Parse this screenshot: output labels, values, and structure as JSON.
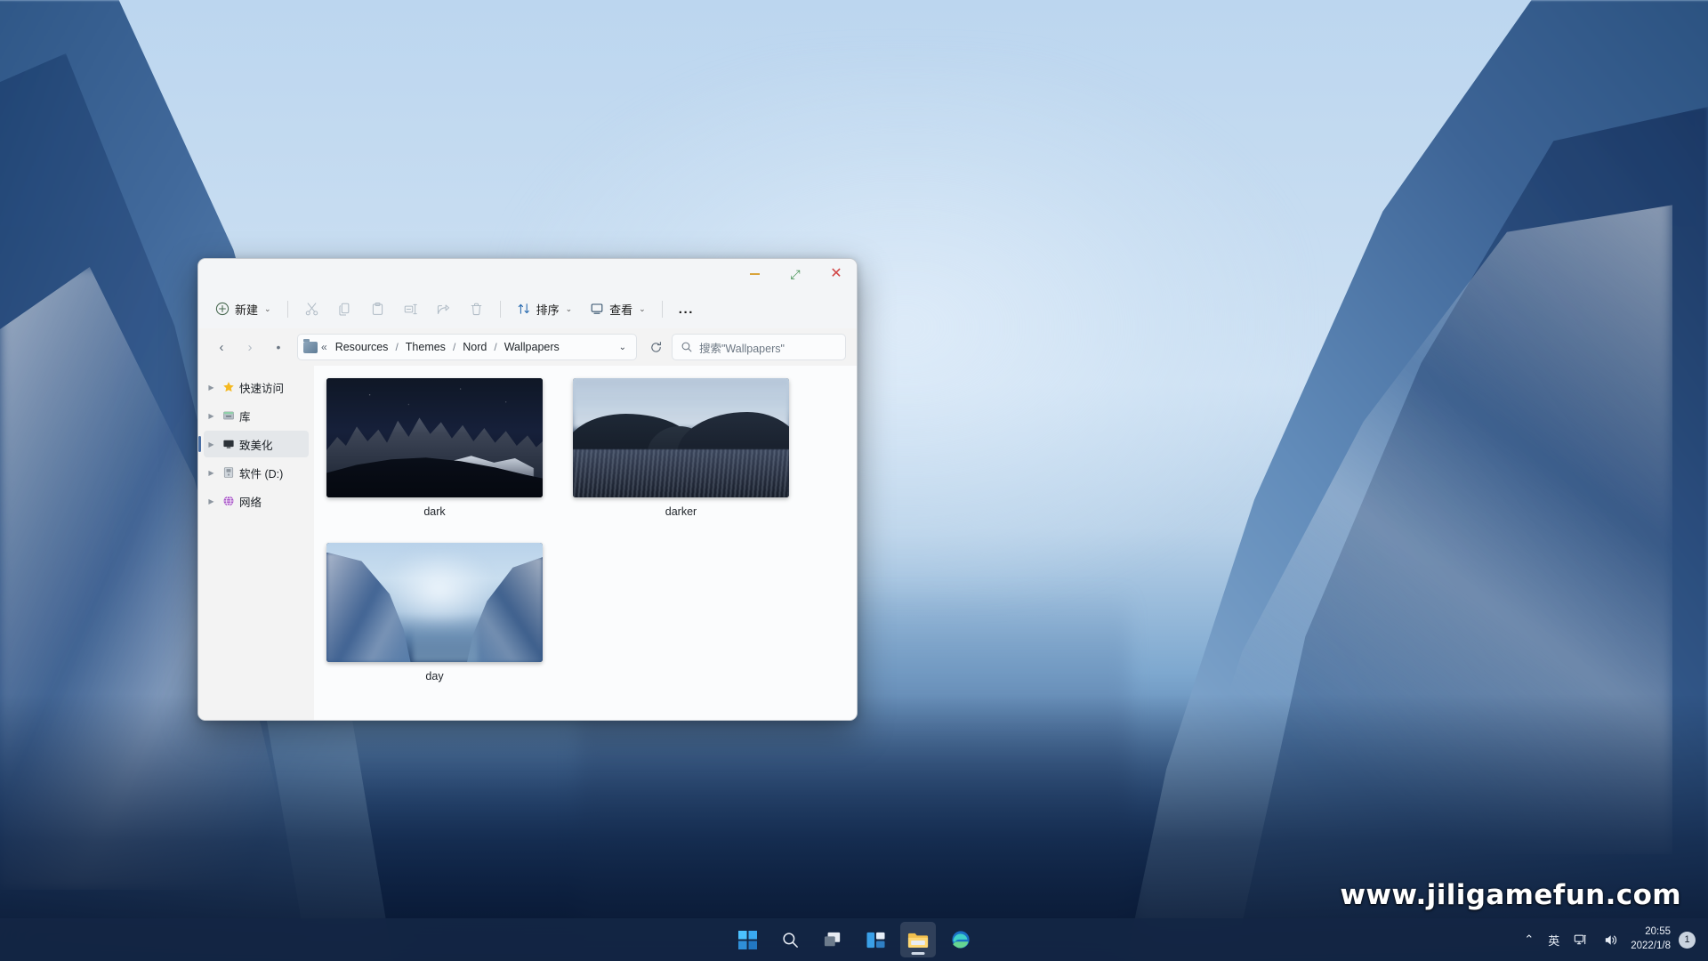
{
  "desktop": {
    "watermark": "www.jiligamefun.com"
  },
  "window": {
    "controls": {
      "minimize": "minimize-button",
      "maximize": "maximize-button",
      "close": "close-button"
    },
    "toolbar": {
      "new_label": "新建",
      "cut_label": "剪切",
      "copy_label": "复制",
      "paste_label": "粘贴",
      "rename_label": "重命名",
      "share_label": "共享",
      "delete_label": "删除",
      "sort_label": "排序",
      "view_label": "查看",
      "more_label": "..."
    },
    "address": {
      "back_label": "←",
      "forward_label": "→",
      "up_label": "↑",
      "overflow_chevron": "«",
      "crumbs": [
        "Resources",
        "Themes",
        "Nord",
        "Wallpapers"
      ],
      "separator": "/",
      "dropdown_label": "⌄",
      "refresh_label": "刷新"
    },
    "search": {
      "placeholder": "搜索\"Wallpapers\"",
      "icon": "search-icon"
    },
    "sidebar": {
      "items": [
        {
          "label": "快速访问",
          "icon": "star-icon",
          "selected": false
        },
        {
          "label": "库",
          "icon": "library-icon",
          "selected": false
        },
        {
          "label": "致美化",
          "icon": "monitor-icon",
          "selected": true
        },
        {
          "label": "软件 (D:)",
          "icon": "drive-icon",
          "selected": false
        },
        {
          "label": "网络",
          "icon": "network-globe-icon",
          "selected": false
        }
      ]
    },
    "files": [
      {
        "name": "dark",
        "art": "dark"
      },
      {
        "name": "darker",
        "art": "darker"
      },
      {
        "name": "day",
        "art": "day"
      }
    ]
  },
  "taskbar": {
    "apps": [
      {
        "name": "start-button",
        "label": "开始"
      },
      {
        "name": "search-button",
        "label": "搜索"
      },
      {
        "name": "task-view-button",
        "label": "任务视图"
      },
      {
        "name": "widgets-button",
        "label": "小组件"
      },
      {
        "name": "file-explorer-button",
        "label": "文件资源管理器",
        "active": true
      },
      {
        "name": "edge-button",
        "label": "Microsoft Edge"
      }
    ],
    "tray": {
      "chevron": "⌃",
      "ime": "英",
      "network": "network-icon",
      "volume": "volume-icon",
      "time": "20:55",
      "date": "2022/1/8",
      "notification_count": "1"
    }
  },
  "colors": {
    "accent": "#4a6fa5",
    "window_bg": "#f3f3f3",
    "content_bg": "#fbfcfd",
    "taskbar": "#142644",
    "close_red": "#d14545",
    "min_yellow": "#d9a43b",
    "max_green": "#3f8f4f"
  }
}
